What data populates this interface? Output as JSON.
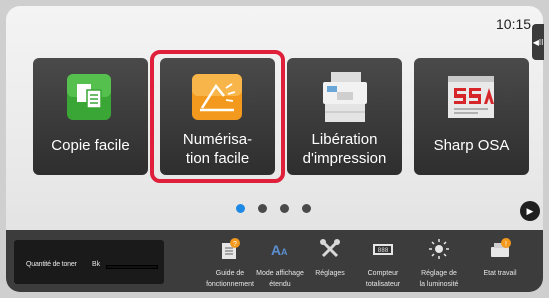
{
  "status": {
    "time": "10:15"
  },
  "side_tab": {
    "glyph": "◀II"
  },
  "tiles": [
    {
      "label": "Copie facile",
      "icon": "copy-icon"
    },
    {
      "label": "Numérisa-\ntion facile",
      "icon": "scan-icon"
    },
    {
      "label": "Libération\nd'impression",
      "icon": "printer-release-icon"
    },
    {
      "label": "Sharp OSA",
      "icon": "osa-icon"
    }
  ],
  "pager": {
    "count": 4,
    "active": 0,
    "next_glyph": "▶"
  },
  "toner": {
    "label": "Quantité de toner",
    "channel": "Bk",
    "level": 1.0
  },
  "status_bar": [
    {
      "label": "Guide de\nfonctionnement",
      "icon": "guide-icon"
    },
    {
      "label": "Mode affichage\nétendu",
      "icon": "text-size-icon"
    },
    {
      "label": "Réglages",
      "icon": "settings-tools-icon"
    },
    {
      "label": "Compteur\ntotalisateur",
      "icon": "counter-icon"
    },
    {
      "label": "Réglage de\nla luminosité",
      "icon": "brightness-icon"
    },
    {
      "label": "Etat travail",
      "icon": "job-status-icon"
    }
  ],
  "colors": {
    "accent": "#1e88e5",
    "highlight": "#e0203a",
    "tile": "#3a3a3a",
    "copy_green": "#3aa635",
    "scan_orange": "#f39a1e",
    "osa_red": "#d6262a"
  }
}
